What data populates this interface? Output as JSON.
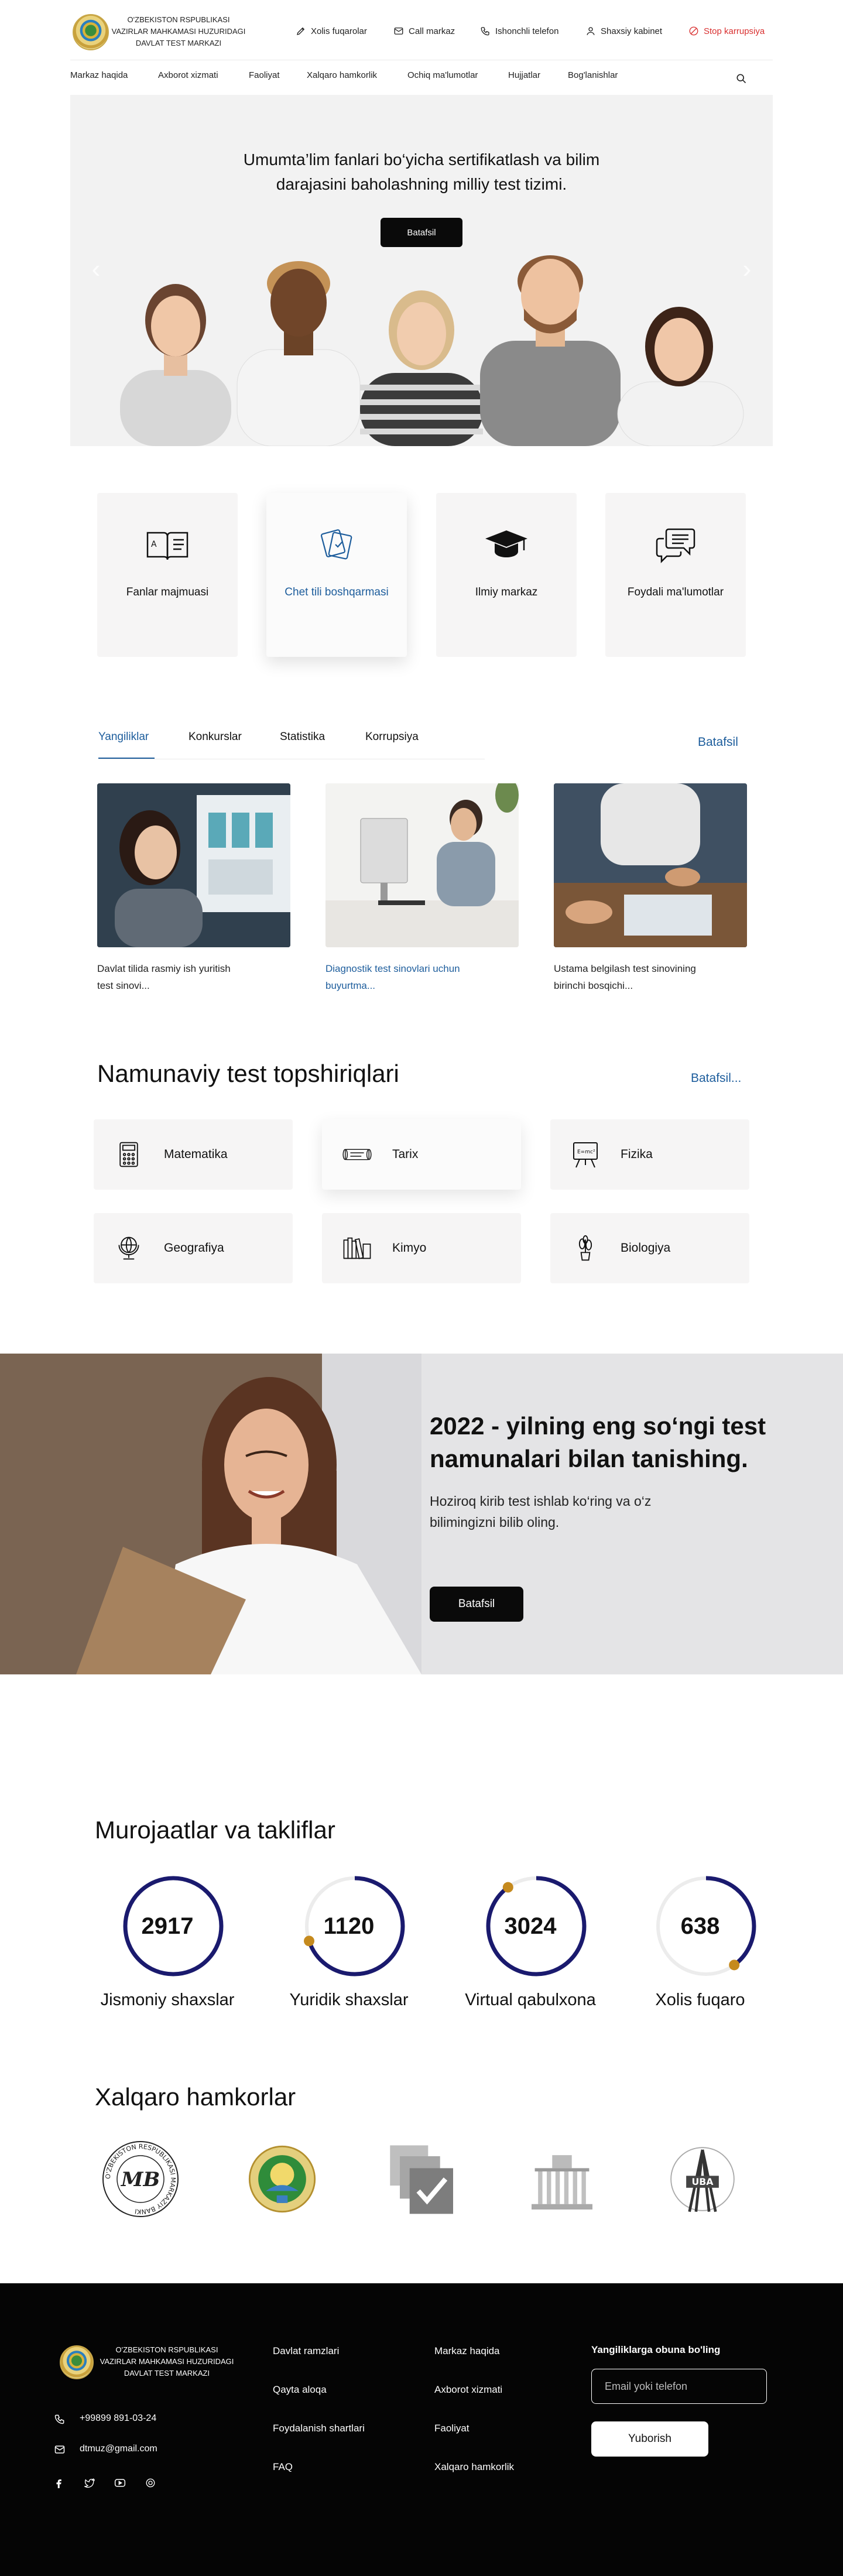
{
  "header": {
    "logo_lines": [
      "O'ZBEKISTON RSPUBLIKASI",
      "VAZIRLAR MAHKAMASI HUZURIDAGI",
      "DAVLAT TEST MARKAZI"
    ],
    "top_links": [
      {
        "label": "Xolis fuqarolar",
        "icon": "pencil-icon"
      },
      {
        "label": "Call markaz",
        "icon": "mail-icon"
      },
      {
        "label": "Ishonchli telefon",
        "icon": "phone-icon"
      },
      {
        "label": "Shaxsiy kabinet",
        "icon": "user-icon"
      },
      {
        "label": "Stop karrupsiya",
        "icon": "stop-icon",
        "color": "#d93030"
      }
    ],
    "nav": [
      "Markaz haqida",
      "Axborot xizmati",
      "Faoliyat",
      "Xalqaro hamkorlik",
      "Ochiq ma'lumotlar",
      "Hujjatlar",
      "Bog'lanishlar"
    ]
  },
  "hero": {
    "title_line1": "Umumta’lim fanlari bo‘yicha sertifikatlash va bilim",
    "title_line2": "darajasini baholashning milliy test tizimi.",
    "button": "Batafsil",
    "prev": "‹",
    "next": "›"
  },
  "services": [
    {
      "label": "Fanlar majmuasi",
      "icon": "book-icon"
    },
    {
      "label": "Chet tili boshqarmasi",
      "icon": "language-cards-icon",
      "active": true
    },
    {
      "label": "Ilmiy markaz",
      "icon": "graduation-cap-icon"
    },
    {
      "label": "Foydali ma'lumotlar",
      "icon": "chat-bubbles-icon"
    }
  ],
  "news": {
    "tabs": [
      "Yangiliklar",
      "Konkurslar",
      "Statistika",
      "Korrupsiya"
    ],
    "more": "Batafsil",
    "items": [
      {
        "caption_line1": "Davlat tilida rasmiy ish yuritish",
        "caption_line2": "test sinovi..."
      },
      {
        "caption_line1": "Diagnostik test sinovlari uchun",
        "caption_line2": "buyurtma..."
      },
      {
        "caption_line1": "Ustama belgilash test sinovining",
        "caption_line2": "birinchi bosqichi..."
      }
    ]
  },
  "samples": {
    "title": "Namunaviy test topshiriqlari",
    "more": "Batafsil...",
    "subjects": [
      {
        "label": "Matematika",
        "icon": "calculator-icon"
      },
      {
        "label": "Tarix",
        "icon": "scroll-icon"
      },
      {
        "label": "Fizika",
        "icon": "blackboard-icon"
      },
      {
        "label": "Geografiya",
        "icon": "globe-icon"
      },
      {
        "label": "Kimyo",
        "icon": "books-icon"
      },
      {
        "label": "Biologiya",
        "icon": "plant-icon"
      }
    ],
    "blackboard_text": "E=mc²"
  },
  "banner": {
    "title_line1": "2022 - yilning eng so‘ngi test",
    "title_line2": "namunalari bilan tanishing.",
    "sub_line1": "Hoziroq kirib test ishlab ko‘ring va o‘z",
    "sub_line2": "bilimingizni bilib oling.",
    "button": "Batafsil"
  },
  "appeals": {
    "title": "Murojaatlar va takliflar",
    "stats": [
      {
        "value": "2917",
        "label": "Jismoniy shaxslar",
        "progress": 1.0
      },
      {
        "value": "1120",
        "label": "Yuridik shaxslar",
        "progress": 0.7
      },
      {
        "value": "3024",
        "label": "Virtual qabulxona",
        "progress": 0.9
      },
      {
        "value": "638",
        "label": "Xolis fuqaro",
        "progress": 0.4
      }
    ],
    "ring_color": "#1a1a6e",
    "dot_color": "#c58a1e"
  },
  "partners": {
    "title": "Xalqaro hamkorlar",
    "logos": [
      {
        "name": "mb-seal-logo",
        "ring_text": "O'ZBEKISTON RESPUBLIKASI MARKAZIY BANKI",
        "mark": "MB"
      },
      {
        "name": "state-emblem-logo"
      },
      {
        "name": "check-documents-logo"
      },
      {
        "name": "building-logo"
      },
      {
        "name": "uba-logo",
        "mark": "UBA"
      }
    ]
  },
  "footer": {
    "logo_lines": [
      "O'ZBEKISTON RSPUBLIKASI",
      "VAZIRLAR MAHKAMASI HUZURIDAGI",
      "DAVLAT TEST MARKAZI"
    ],
    "phone": "+99899 891-03-24",
    "email": "dtmuz@gmail.com",
    "col1": [
      "Davlat ramzlari",
      "Qayta aloqa",
      "Foydalanish shartlari",
      "FAQ"
    ],
    "col2": [
      "Markaz haqida",
      "Axborot xizmati",
      "Faoliyat",
      "Xalqaro hamkorlik"
    ],
    "subscribe_title": "Yangiliklarga obuna bo'ling",
    "input_placeholder": "Email yoki telefon",
    "submit": "Yuborish",
    "socials": [
      "facebook-icon",
      "twitter-icon",
      "youtube-icon",
      "instagram-icon"
    ]
  }
}
